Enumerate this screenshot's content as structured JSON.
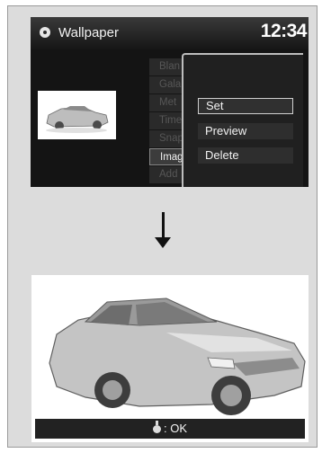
{
  "screen_top": {
    "title": "Wallpaper",
    "title_icon": "gear-icon",
    "clock": "12:34",
    "thumbnail": "car-thumbnail-icon",
    "list_items": [
      "Blan",
      "Gala",
      "Met",
      "Time",
      "Snap",
      "Imag",
      "Add"
    ],
    "list_active_index": 5,
    "popup_menu": [
      "Set",
      "Preview",
      "Delete"
    ],
    "popup_selected_index": 0
  },
  "arrow": "down-arrow-icon",
  "screen_bottom": {
    "image": "car-wallpaper",
    "status_icon": "selector-dial-icon",
    "status_text": ": OK"
  }
}
